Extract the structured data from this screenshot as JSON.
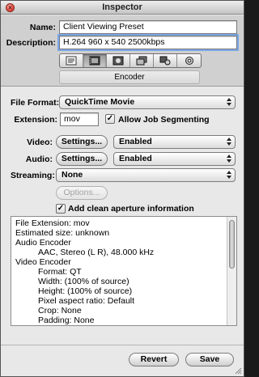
{
  "window": {
    "title": "Inspector"
  },
  "preset": {
    "name_label": "Name:",
    "name_value": "Client Viewing Preset",
    "description_label": "Description:",
    "description_value": "H.264 960 x 540 2500kbps"
  },
  "tabs": {
    "icons": [
      "summary-icon",
      "encoder-icon",
      "frame-controls-icon",
      "filters-icon",
      "geometry-icon",
      "actions-icon"
    ],
    "active_label": "Encoder"
  },
  "encoder": {
    "file_format_label": "File Format:",
    "file_format_value": "QuickTime Movie",
    "extension_label": "Extension:",
    "extension_value": "mov",
    "allow_segmenting_label": "Allow Job Segmenting",
    "allow_segmenting_checked": true,
    "video_label": "Video:",
    "video_settings_label": "Settings...",
    "video_state": "Enabled",
    "audio_label": "Audio:",
    "audio_settings_label": "Settings...",
    "audio_state": "Enabled",
    "streaming_label": "Streaming:",
    "streaming_value": "None",
    "options_label": "Options...",
    "clean_aperture_label": "Add clean aperture information",
    "clean_aperture_checked": true
  },
  "summary": {
    "lines": [
      "File Extension: mov",
      "Estimated size: unknown",
      "Audio Encoder",
      "AAC, Stereo (L R), 48.000 kHz",
      "Video Encoder",
      "Format: QT",
      "Width: (100% of source)",
      "Height: (100% of source)",
      "Pixel aspect ratio: Default",
      "Crop: None",
      "Padding: None"
    ]
  },
  "footer": {
    "revert_label": "Revert",
    "save_label": "Save"
  }
}
